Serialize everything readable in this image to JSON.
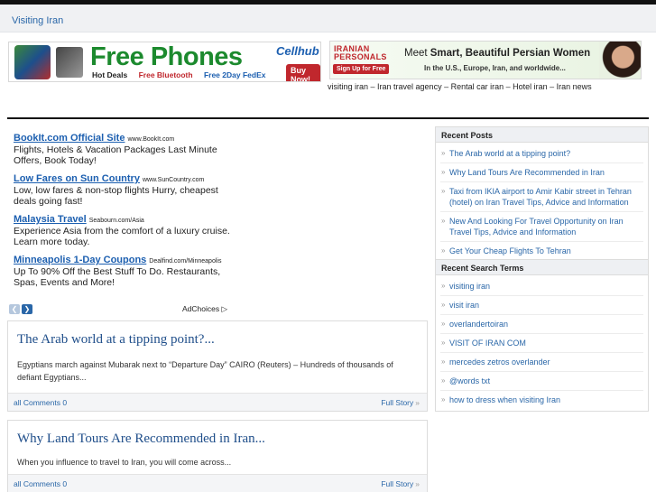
{
  "site": {
    "title": "Visiting Iran"
  },
  "ad_banner_1": {
    "headline": "Free Phones",
    "brand": "Cellhub",
    "sub_1": "Hot Deals",
    "sub_2": "Free Bluetooth",
    "sub_3": "Free 2Day FedEx",
    "cta": "Buy Now!"
  },
  "ad_banner_2": {
    "logo_line_1": "IRANIAN",
    "logo_line_2": "PERSONALS",
    "signup": "Sign Up for Free",
    "headline_pre": "Meet ",
    "headline_bold": "Smart, Beautiful Persian Women",
    "sub": "In the U.S., Europe, Iran, and worldwide..."
  },
  "tagline": "visiting iran – Iran travel agency – Rental car iran – Hotel iran – Iran news",
  "sponsored": [
    {
      "title": "BookIt.com Official Site",
      "domain": "www.BookIt.com",
      "desc": "Flights, Hotels & Vacation Packages Last Minute Offers, Book Today!"
    },
    {
      "title": "Low Fares on Sun Country",
      "domain": "www.SunCountry.com",
      "desc": "Low, low fares & non-stop flights Hurry, cheapest deals going fast!"
    },
    {
      "title": "Malaysia Travel",
      "domain": "Seabourn.com/Asia",
      "desc": "Experience Asia from the comfort of a luxury cruise. Learn more today."
    },
    {
      "title": "Minneapolis 1-Day Coupons",
      "domain": "Dealfind.com/Minneapolis",
      "desc": "Up To 90% Off the Best Stuff To Do. Restaurants, Spas, Events and More!"
    }
  ],
  "adchoices": "AdChoices",
  "posts": [
    {
      "title": "The Arab world at a tipping point?...",
      "excerpt": "Egyptians march against Mubarak next to “Departure Day” CAIRO (Reuters) – Hundreds of thousands of defiant Egyptians...",
      "comments": "all Comments 0",
      "more": "Full Story"
    },
    {
      "title": "Why Land Tours Are Recommended in Iran...",
      "excerpt": "When you influence to travel to Iran, you will come across...",
      "comments": "all Comments 0",
      "more": "Full Story"
    }
  ],
  "sidebar": {
    "recent_posts_title": "Recent Posts",
    "recent_posts": [
      "The Arab world at a tipping point?",
      "Why Land Tours Are Recommended in Iran",
      "Taxi from IKIA airport to Amir Kabir street in Tehran (hotel) on Iran Travel Tips, Advice and Information",
      "New And Looking For Travel Opportunity on Iran Travel Tips, Advice and Information",
      "Get Your Cheap Flights To Tehran"
    ],
    "search_terms_title": "Recent Search Terms",
    "search_terms": [
      "visiting iran",
      "visit iran",
      "overlandertoiran",
      "VISIT OF IRAN COM",
      "mercedes zetros overlander",
      "@words txt",
      "how to dress when visiting Iran"
    ]
  }
}
